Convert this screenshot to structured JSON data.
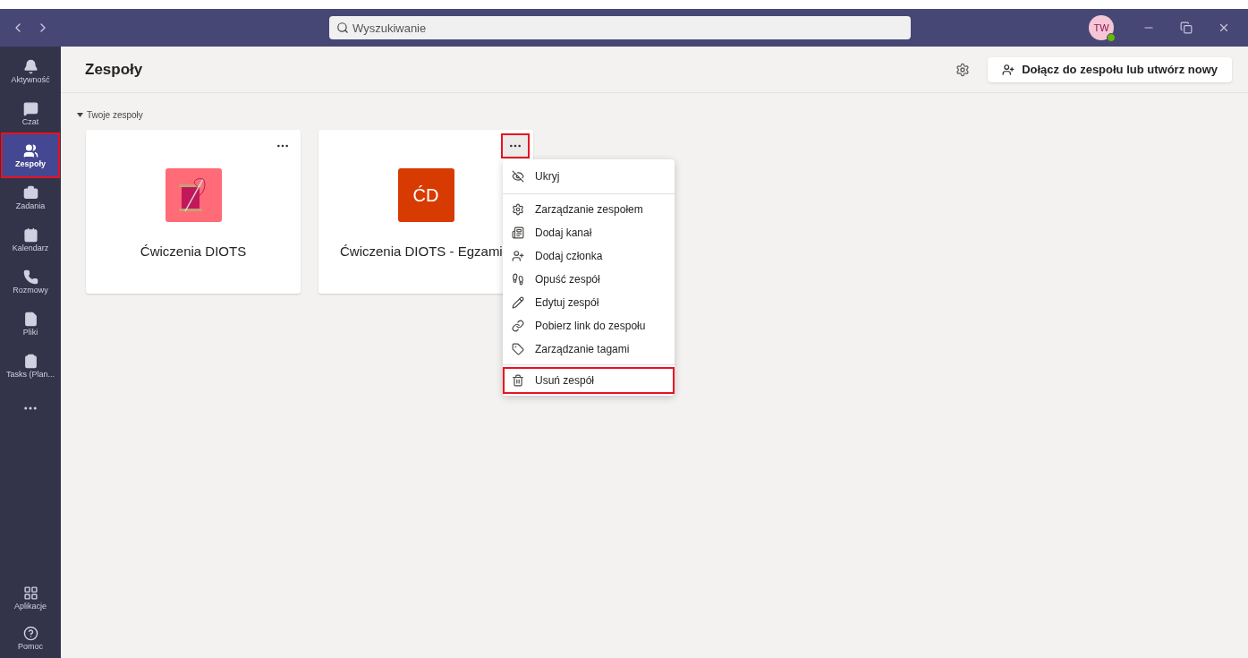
{
  "title_bar": {
    "search": {
      "placeholder": "Wyszukiwanie"
    },
    "avatar": {
      "initials": "TW"
    }
  },
  "sidebar": {
    "items": [
      {
        "label": "Aktywność",
        "selected": false,
        "highlighted": false
      },
      {
        "label": "Czat",
        "selected": false,
        "highlighted": false
      },
      {
        "label": "Zespoły",
        "selected": true,
        "highlighted": true
      },
      {
        "label": "Zadania",
        "selected": false,
        "highlighted": false
      },
      {
        "label": "Kalendarz",
        "selected": false,
        "highlighted": false
      },
      {
        "label": "Rozmowy",
        "selected": false,
        "highlighted": false
      },
      {
        "label": "Pliki",
        "selected": false,
        "highlighted": false
      },
      {
        "label": "Tasks (Plan...",
        "selected": false,
        "highlighted": false
      }
    ],
    "bottom_items": [
      {
        "label": "Aplikacje"
      },
      {
        "label": "Pomoc"
      }
    ]
  },
  "header": {
    "title": "Zespoły",
    "join_button": "Dołącz do zespołu lub utwórz nowy"
  },
  "section": {
    "label": "Twoje zespoły",
    "expanded": true
  },
  "teams": [
    {
      "name": "Ćwiczenia DIOTS",
      "kind": "image",
      "color": "#ff6b77",
      "more_highlighted": false,
      "menu_open": false
    },
    {
      "name": "Ćwiczenia DIOTS - Egzami",
      "kind": "initials",
      "initials": "ĆD",
      "color": "#d83b01",
      "more_highlighted": true,
      "menu_open": true
    }
  ],
  "context_menu": {
    "items": [
      {
        "label": "Ukryj",
        "highlighted": false
      },
      {
        "label": "Zarządzanie zespołem",
        "highlighted": false
      },
      {
        "label": "Dodaj kanał",
        "highlighted": false
      },
      {
        "label": "Dodaj członka",
        "highlighted": false
      },
      {
        "label": "Opuść zespół",
        "highlighted": false
      },
      {
        "label": "Edytuj zespół",
        "highlighted": false
      },
      {
        "label": "Pobierz link do zespołu",
        "highlighted": false
      },
      {
        "label": "Zarządzanie tagami",
        "highlighted": false
      },
      {
        "label": "Usuń zespół",
        "highlighted": true
      }
    ]
  }
}
